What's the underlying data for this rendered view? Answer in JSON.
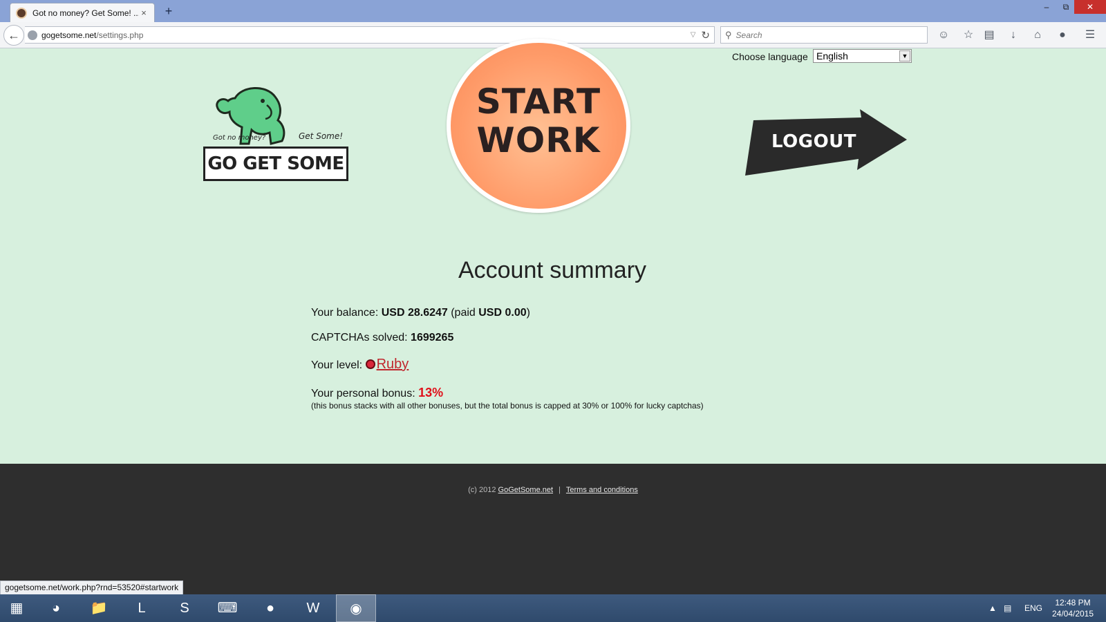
{
  "browser": {
    "tab_title": "Got no money? Get Some! ...",
    "tab_close": "×",
    "new_tab": "+",
    "url_host": "gogetsome.net",
    "url_path": "/settings.php",
    "search_placeholder": "Search",
    "status_url": "gogetsome.net/work.php?rnd=53520#startwork"
  },
  "page": {
    "language_label": "Choose language",
    "language_selected": "English",
    "logo_tagline_left": "Got no money?",
    "logo_tagline_right": "Get Some!",
    "logo_text": "GO GET SOME",
    "start_line1": "START",
    "start_line2": "WORK",
    "logout_label": "LOGOUT"
  },
  "summary": {
    "title": "Account summary",
    "balance_label": "Your balance: ",
    "balance_value": "USD 28.6247",
    "paid_prefix": " (paid ",
    "paid_value": "USD 0.00",
    "paid_suffix": ")",
    "captchas_label": "CAPTCHAs solved: ",
    "captchas_value": "1699265",
    "level_label": "Your level: ",
    "level_value": "Ruby",
    "bonus_label": "Your personal bonus: ",
    "bonus_value": "13%",
    "bonus_note": "(this bonus stacks with all other bonuses, but the total bonus is capped at 30% or 100% for lucky captchas)"
  },
  "footer": {
    "copyright": "(c) 2012 ",
    "site_link": "GoGetSome.net",
    "separator": "|",
    "terms_link": "Terms and conditions"
  },
  "taskbar": {
    "language": "ENG",
    "time": "12:48 PM",
    "date": "24/04/2015"
  },
  "colors": {
    "page_bg": "#d7f0de",
    "start_button": "#ff9c6a",
    "bonus_red": "#e0101a",
    "footer_bg": "#2e2e2e"
  }
}
